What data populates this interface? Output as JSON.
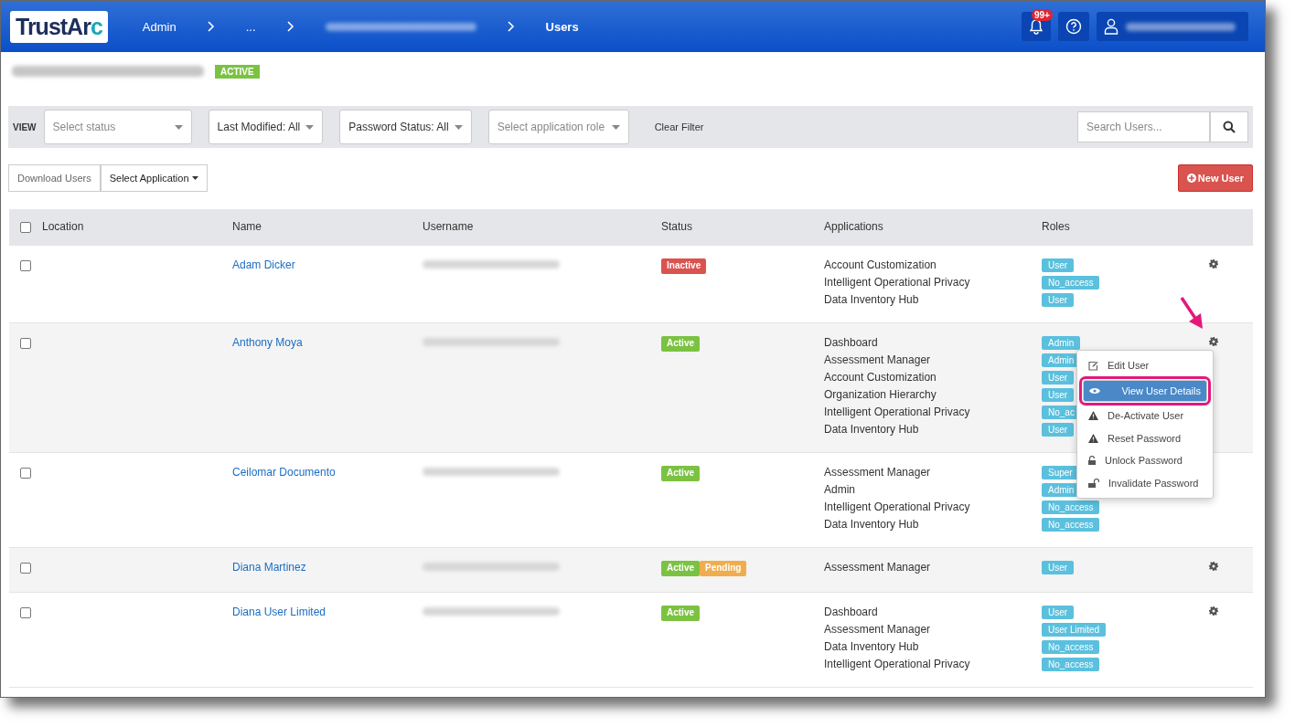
{
  "header": {
    "logo": {
      "text": "TrustAr",
      "accent": "c"
    },
    "breadcrumbs": [
      {
        "kind": "link",
        "label": "Admin"
      },
      {
        "kind": "link",
        "label": "..."
      },
      {
        "kind": "redacted"
      },
      {
        "kind": "current",
        "label": "Users"
      }
    ],
    "notifications_badge": "99+"
  },
  "org": {
    "status_badge": "ACTIVE"
  },
  "filters": {
    "view_label": "VIEW",
    "status_select": {
      "placeholder": "Select status"
    },
    "last_modified": "Last Modified: All",
    "password_status": "Password Status: All",
    "role_select": {
      "placeholder": "Select application role"
    },
    "clear": "Clear Filter",
    "search": {
      "placeholder": "Search Users..."
    }
  },
  "actions": {
    "download": "Download Users",
    "select_application": "Select Application",
    "new_user": "New User"
  },
  "table": {
    "all_checked": false,
    "columns": [
      "Location",
      "Name",
      "Username",
      "Status",
      "Applications",
      "Roles"
    ],
    "rows": [
      {
        "checked": false,
        "name": "Adam Dicker",
        "status": [
          {
            "label": "Inactive",
            "color": "#d9534f"
          }
        ],
        "applications": [
          "Account Customization",
          "Intelligent Operational Privacy",
          "Data Inventory Hub"
        ],
        "roles": [
          "User",
          "No_access",
          "User"
        ],
        "gear_visible": true,
        "menu_open": false
      },
      {
        "checked": false,
        "name": "Anthony Moya",
        "status": [
          {
            "label": "Active",
            "color": "#7cc242"
          }
        ],
        "applications": [
          "Dashboard",
          "Assessment Manager",
          "Account Customization",
          "Organization Hierarchy",
          "Intelligent Operational Privacy",
          "Data Inventory Hub"
        ],
        "roles": [
          "Admin",
          "Admin",
          "User",
          "User",
          "No_ac",
          "User"
        ],
        "gear_visible": true,
        "menu_open": true
      },
      {
        "checked": false,
        "name": "Ceilomar Documento",
        "status": [
          {
            "label": "Active",
            "color": "#7cc242"
          }
        ],
        "applications": [
          "Assessment Manager",
          "Admin",
          "Intelligent Operational Privacy",
          "Data Inventory Hub"
        ],
        "roles": [
          "Super",
          "Admin",
          "No_access",
          "No_access"
        ],
        "gear_visible": false,
        "menu_open": false
      },
      {
        "checked": false,
        "name": "Diana Martinez",
        "status": [
          {
            "label": "Active",
            "color": "#7cc242"
          },
          {
            "label": "Pending",
            "color": "#f0ad4e"
          }
        ],
        "applications": [
          "Assessment Manager"
        ],
        "roles": [
          "User"
        ],
        "gear_visible": true,
        "menu_open": false
      },
      {
        "checked": false,
        "name": "Diana User Limited",
        "status": [
          {
            "label": "Active",
            "color": "#7cc242"
          }
        ],
        "applications": [
          "Dashboard",
          "Assessment Manager",
          "Data Inventory Hub",
          "Intelligent Operational Privacy"
        ],
        "roles": [
          "User",
          "User Limited",
          "No_access",
          "No_access"
        ],
        "gear_visible": true,
        "menu_open": false
      }
    ]
  },
  "row_menu": [
    {
      "kind": "edit",
      "label": "Edit User",
      "selected": false
    },
    {
      "kind": "view",
      "label": "View User Details",
      "selected": true
    },
    {
      "kind": "warning",
      "label": "De-Activate User",
      "selected": false
    },
    {
      "kind": "warning",
      "label": "Reset Password",
      "selected": false
    },
    {
      "kind": "lock",
      "label": "Unlock Password",
      "selected": false
    },
    {
      "kind": "unlock",
      "label": "Invalidate Password",
      "selected": false
    }
  ]
}
